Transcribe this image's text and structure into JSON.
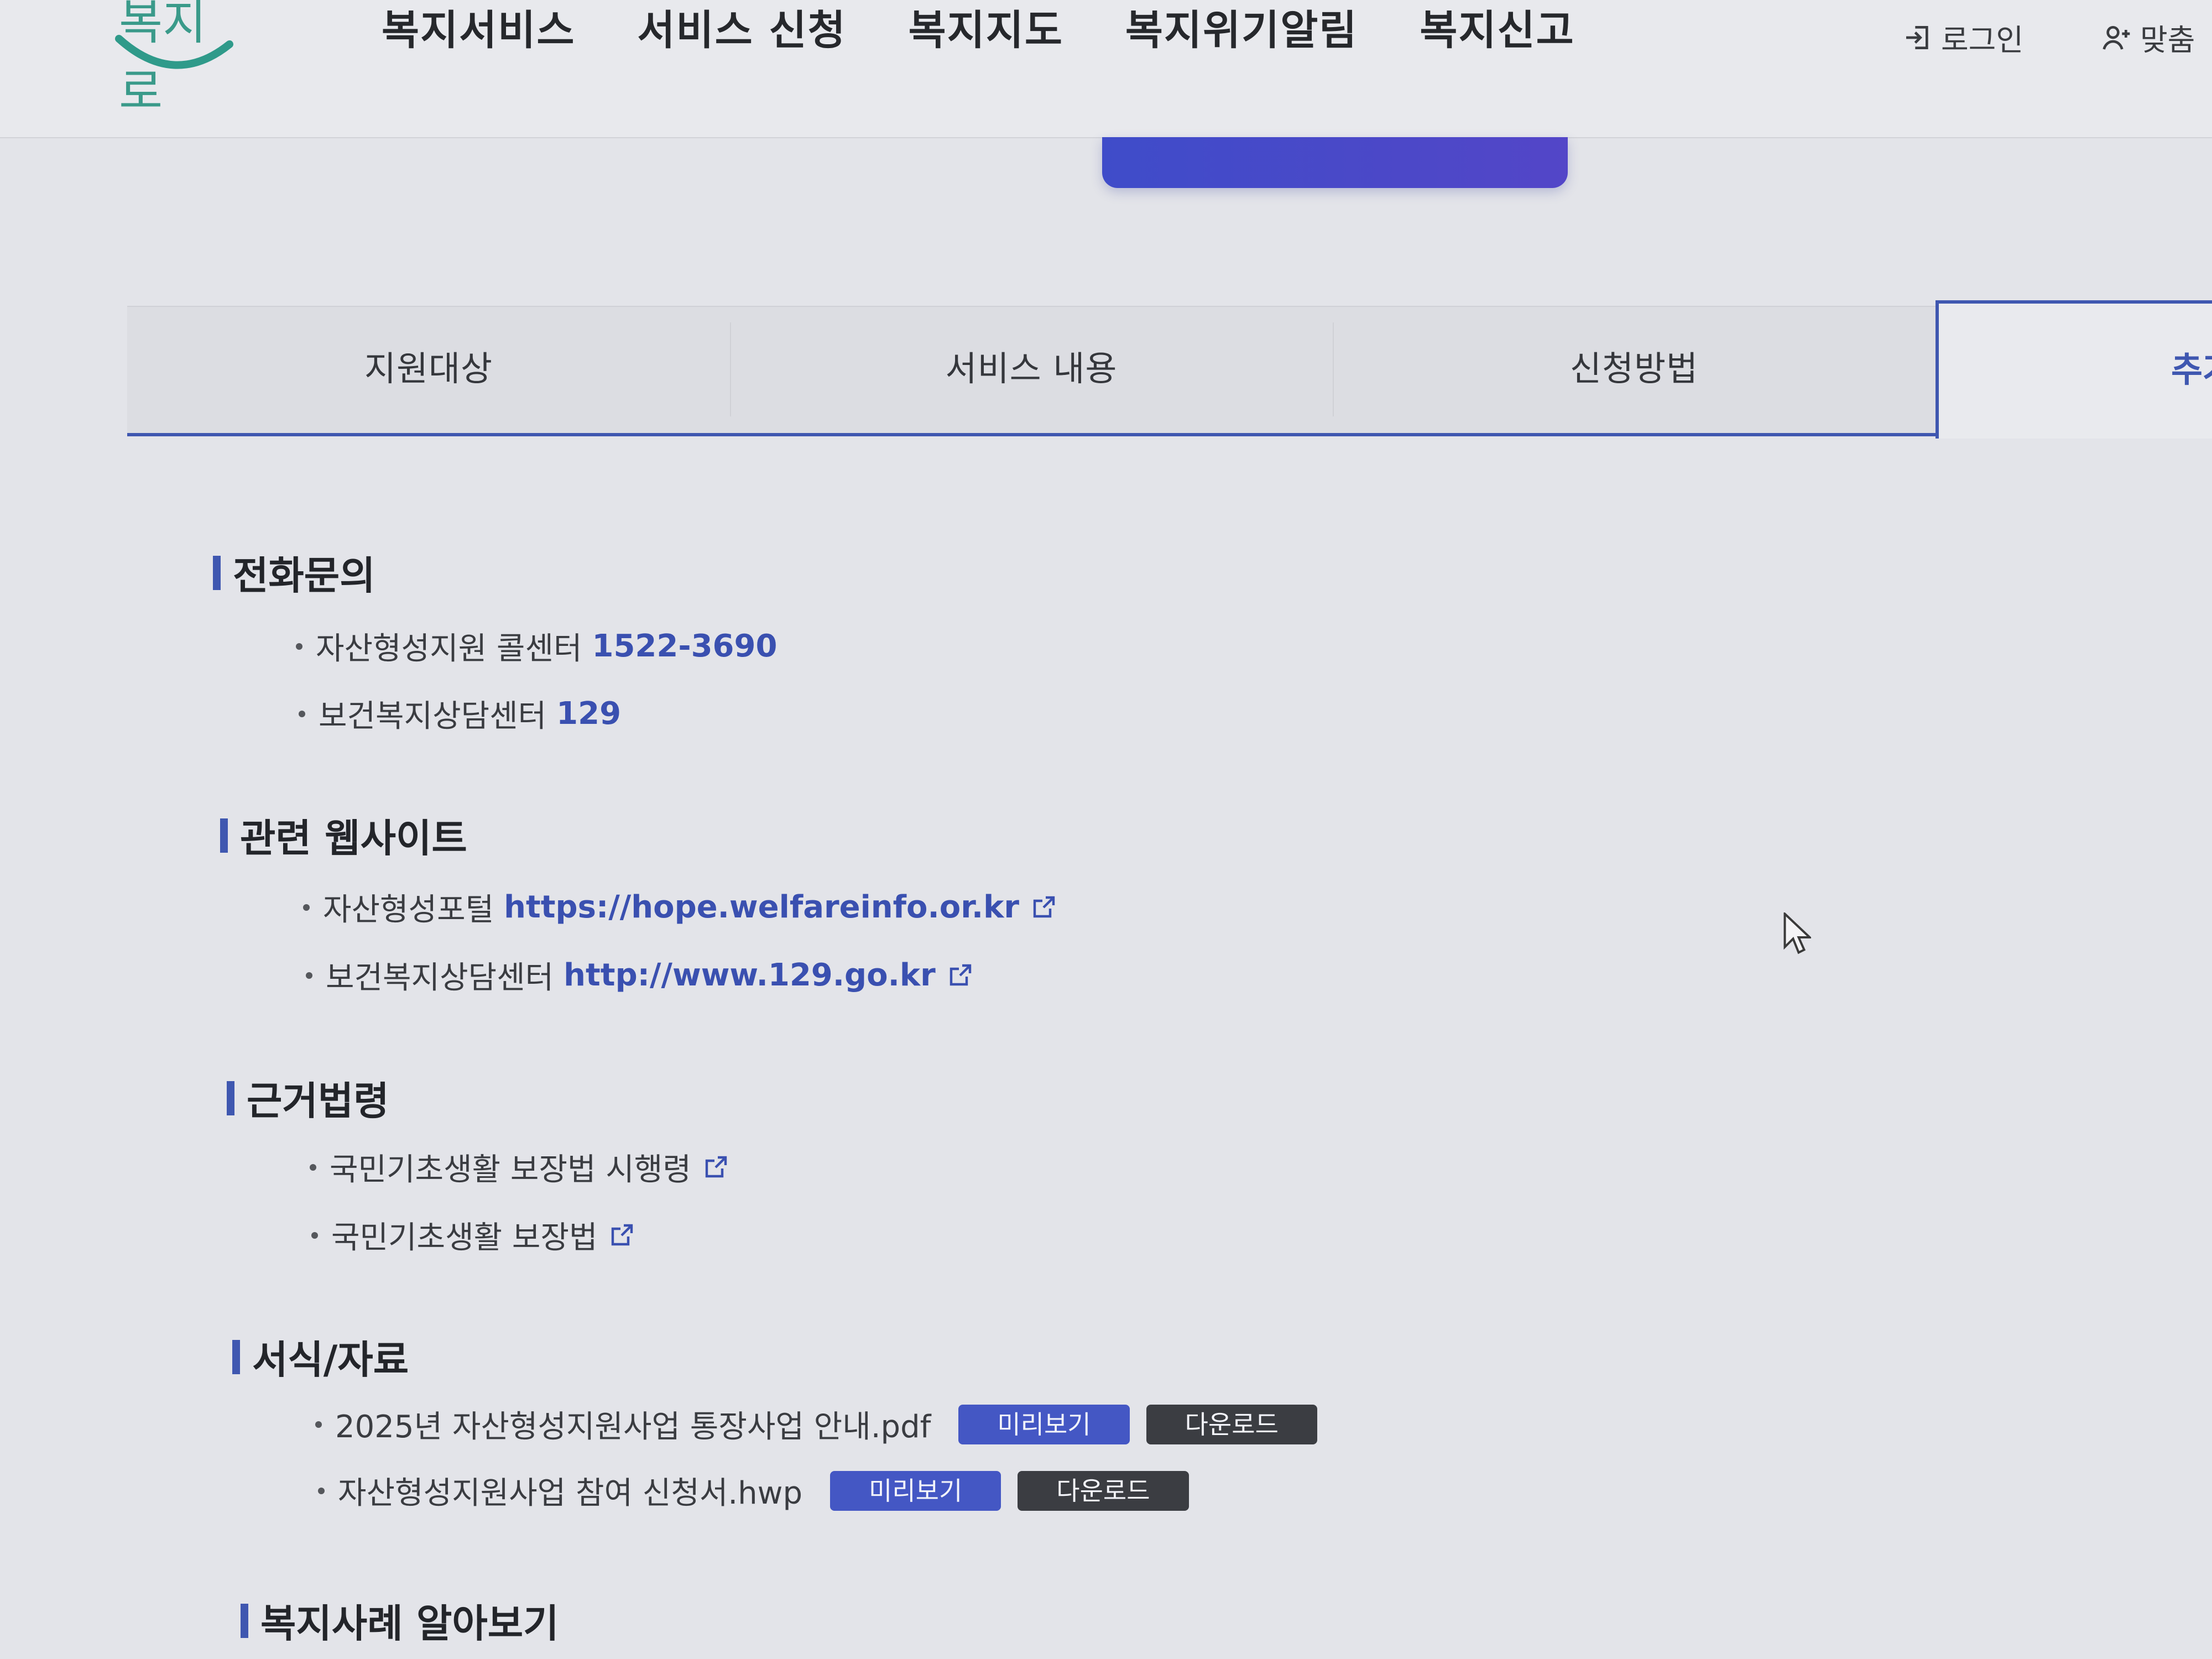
{
  "header": {
    "logo_text": "복지로",
    "nav": [
      "복지서비스",
      "서비스 신청",
      "복지지도",
      "복지위기알림",
      "복지신고"
    ],
    "login_label": "로그인",
    "custom_label": "맞춤"
  },
  "tabs": {
    "items": [
      "지원대상",
      "서비스 내용",
      "신청방법"
    ],
    "active_partial": "추가"
  },
  "sections": {
    "phone": {
      "title": "전화문의",
      "items": [
        {
          "label": "자산형성지원 콜센터",
          "value": "1522-3690"
        },
        {
          "label": "보건복지상담센터",
          "value": "129"
        }
      ]
    },
    "websites": {
      "title": "관련 웹사이트",
      "items": [
        {
          "label": "자산형성포털",
          "value": "https://hope.welfareinfo.or.kr"
        },
        {
          "label": "보건복지상담센터",
          "value": "http://www.129.go.kr"
        }
      ]
    },
    "laws": {
      "title": "근거법령",
      "items": [
        {
          "label": "국민기초생활 보장법 시행령"
        },
        {
          "label": "국민기초생활 보장법"
        }
      ]
    },
    "forms": {
      "title": "서식/자료",
      "preview_label": "미리보기",
      "download_label": "다운로드",
      "items": [
        {
          "label": "2025년 자산형성지원사업 통장사업 안내.pdf"
        },
        {
          "label": "자산형성지원사업 참여 신청서.hwp"
        }
      ]
    },
    "cases": {
      "title": "복지사례 알아보기"
    }
  },
  "colors": {
    "accent": "#3f57b0",
    "link": "#3a50b0",
    "preview_button": "#4457c4",
    "download_button": "#3b3d42",
    "logo_teal": "#3a9a8a"
  }
}
